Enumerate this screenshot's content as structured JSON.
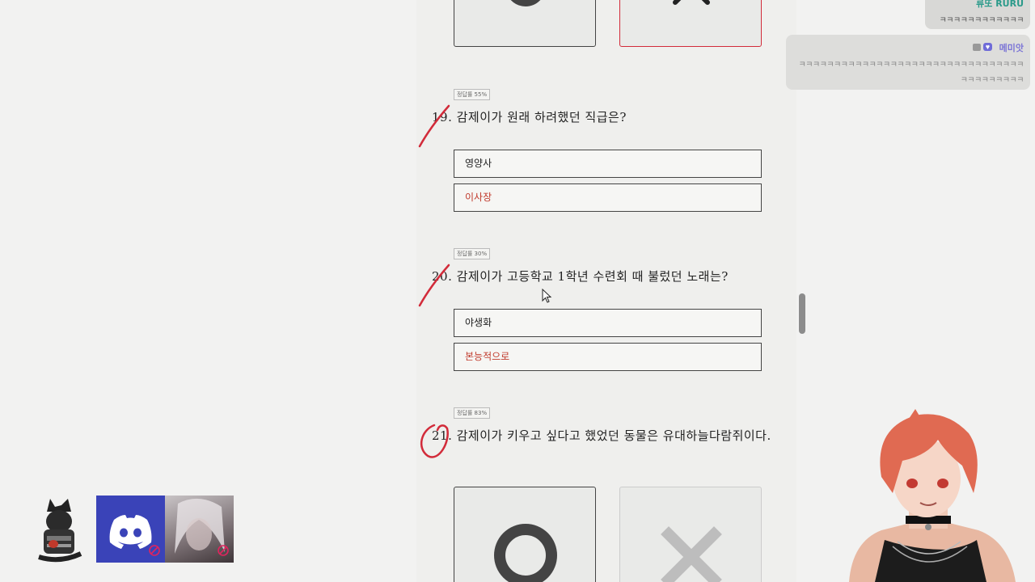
{
  "quiz": {
    "top_choices": {
      "left_symbol": "O",
      "right_symbol": "X"
    },
    "questions": [
      {
        "rate": "정답률 55%",
        "text": "19. 감제이가 원래 하려했던 직급은?",
        "answers": [
          "영양사",
          "이사장"
        ],
        "result": "wrong"
      },
      {
        "rate": "정답률 30%",
        "text": "20. 감제이가 고등학교 1학년 수련회 때 불렀던 노래는?",
        "answers": [
          "야생화",
          "본능적으로"
        ],
        "result": "wrong"
      },
      {
        "rate": "정답률 83%",
        "text": "21. 감제이가 키우고 싶다고 했었던 동물은 유대하늘다람쥐이다.",
        "choice_o": "O",
        "choice_x": "X",
        "result": "correct"
      }
    ]
  },
  "chat": {
    "messages": [
      {
        "user": "류또 RURU",
        "text": "ㅋㅋㅋㅋㅋㅋㅋㅋㅋㅋㅋㅋ",
        "name_color": "#2a9a8a"
      },
      {
        "user": "메미앗",
        "text": "ㅋㅋㅋㅋㅋㅋㅋㅋㅋㅋㅋㅋㅋㅋㅋㅋㅋㅋㅋㅋㅋㅋㅋㅋㅋㅋㅋㅋㅋㅋㅋㅋㅋㅋㅋㅋㅋㅋㅋㅋㅋ",
        "name_color": "#7b74d6"
      }
    ]
  },
  "overlays": {
    "accent_red": "#d22b3a",
    "discord_color": "#3a43b8"
  }
}
